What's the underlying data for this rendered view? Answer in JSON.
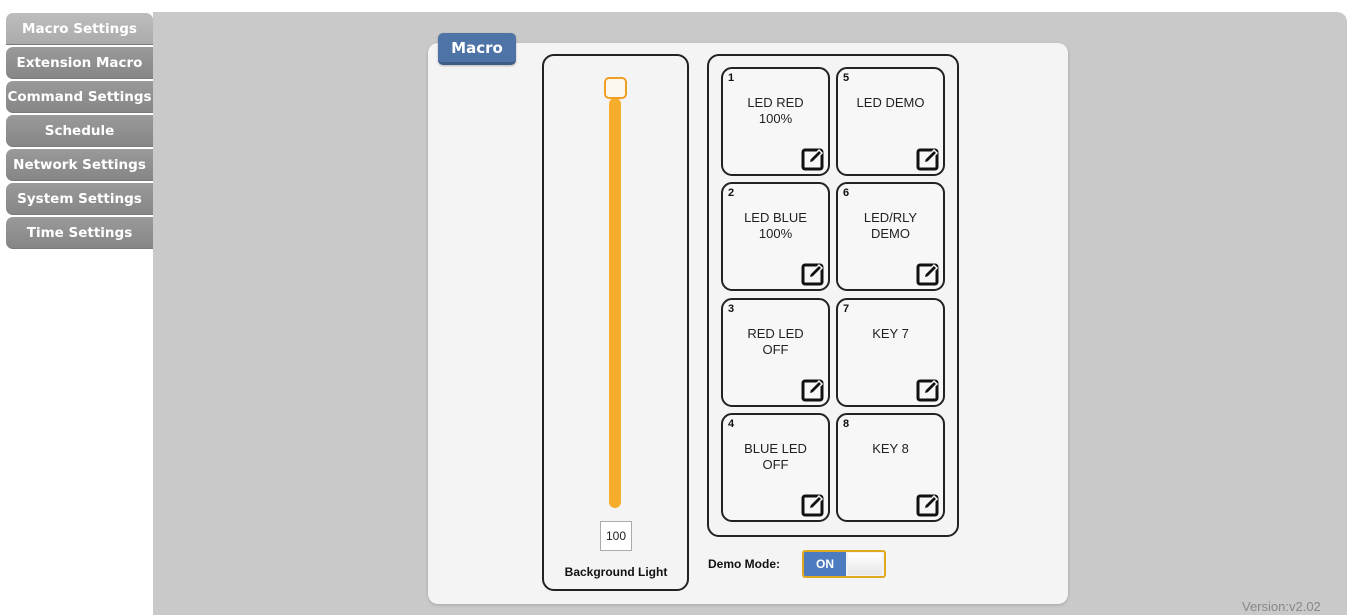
{
  "sidebar": {
    "items": [
      {
        "label": "Macro Settings",
        "active": true
      },
      {
        "label": "Extension Macro"
      },
      {
        "label": "Command Settings"
      },
      {
        "label": "Schedule"
      },
      {
        "label": "Network Settings"
      },
      {
        "label": "System Settings"
      },
      {
        "label": "Time Settings"
      }
    ]
  },
  "panel": {
    "title": "Macro",
    "background_light": {
      "value": "100",
      "label": "Background Light"
    },
    "keys": [
      {
        "num": "1",
        "label": "LED RED\n100%"
      },
      {
        "num": "2",
        "label": "LED BLUE\n100%"
      },
      {
        "num": "3",
        "label": "RED LED\nOFF"
      },
      {
        "num": "4",
        "label": "BLUE LED\nOFF"
      },
      {
        "num": "5",
        "label": "LED DEMO"
      },
      {
        "num": "6",
        "label": "LED/RLY\nDEMO"
      },
      {
        "num": "7",
        "label": "KEY 7"
      },
      {
        "num": "8",
        "label": "KEY 8"
      }
    ],
    "edit_icon": "edit-icon",
    "demo_mode": {
      "label": "Demo Mode:",
      "state": "ON"
    }
  },
  "colors": {
    "accent": "#4e74a7",
    "slider": "#f7ad2c",
    "toggle_on": "#4c7bbf"
  },
  "version": "Version:v2.02"
}
